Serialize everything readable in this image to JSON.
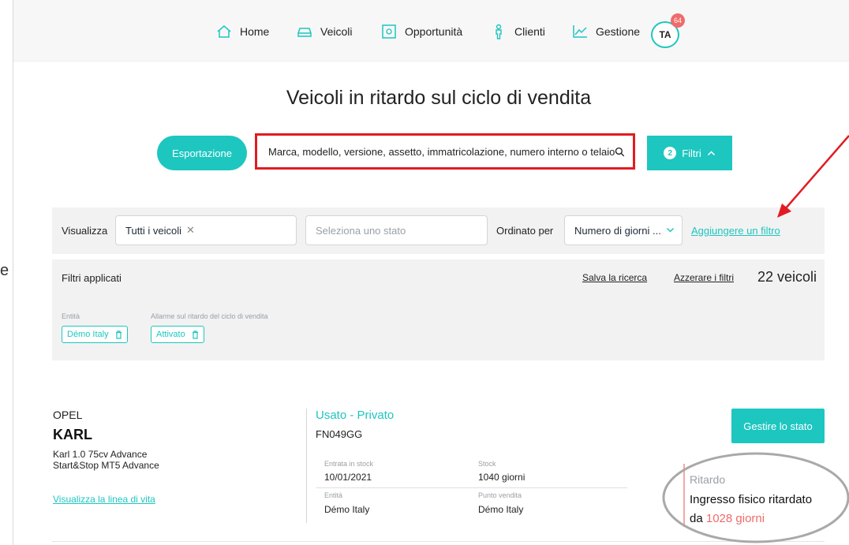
{
  "stray_glyph": "e",
  "nav": {
    "items": [
      {
        "label": "Home",
        "icon": "home-icon"
      },
      {
        "label": "Veicoli",
        "icon": "car-icon"
      },
      {
        "label": "Opportunità",
        "icon": "opportunity-icon"
      },
      {
        "label": "Clienti",
        "icon": "person-icon"
      },
      {
        "label": "Gestione",
        "icon": "chart-icon"
      }
    ],
    "avatar": "TA",
    "badge": "64"
  },
  "page": {
    "title": "Veicoli in ritardo sul ciclo di vendita"
  },
  "toolbar": {
    "export_label": "Esportazione",
    "search_placeholder": "Marca, modello, versione, assetto, immatricolazione, numero interno o telaio",
    "filters_count": "2",
    "filters_label": "Filtri"
  },
  "filter_bar": {
    "view_label": "Visualizza",
    "view_value": "Tutti i veicoli",
    "state_placeholder": "Seleziona uno stato",
    "sort_label": "Ordinato per",
    "sort_value": "Numero di giorni ...",
    "add_filter": "Aggiungere un filtro"
  },
  "applied": {
    "title": "Filtri applicati",
    "save_search": "Salva la ricerca",
    "reset_filters": "Azzerare i filtri",
    "count": "22 veicoli",
    "chips": [
      {
        "label": "Entità",
        "value": "Démo Italy"
      },
      {
        "label": "Allarme sul ritardo del ciclo di vendita",
        "value": "Attivato"
      }
    ]
  },
  "vehicle": {
    "make": "OPEL",
    "model": "KARL",
    "version": "Karl 1.0 75cv Advance Start&Stop MT5 Advance",
    "lifeline_link": "Visualizza la linea di vita",
    "type": "Usato - Privato",
    "plate": "FN049GG",
    "stock_entry_label": "Entrata in stock",
    "stock_entry_value": "10/01/2021",
    "stock_label": "Stock",
    "stock_value": "1040 giorni",
    "entity_label": "Entità",
    "entity_value": "Démo Italy",
    "point_label": "Punto vendita",
    "point_value": "Démo Italy",
    "manage_state": "Gestire lo stato",
    "delay_label": "Ritardo",
    "delay_line1": "Ingresso fisico ritardato",
    "delay_prefix": "da ",
    "delay_days": "1028 giorni"
  },
  "colors": {
    "accent": "#1ec6c0",
    "highlight_red": "#e11b22",
    "delay_red": "#f06b6b"
  }
}
